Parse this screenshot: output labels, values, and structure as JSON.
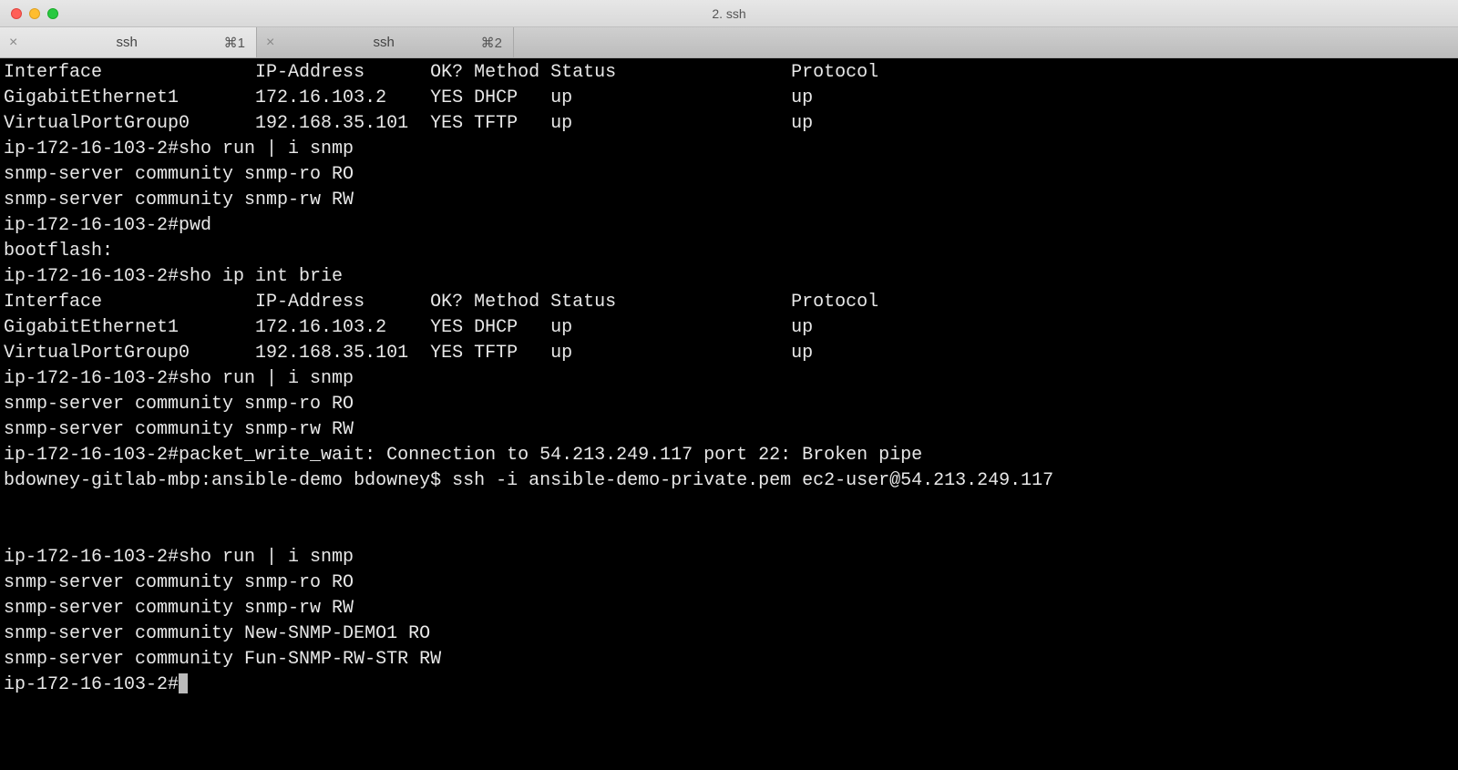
{
  "window": {
    "title": "2. ssh"
  },
  "tabs": [
    {
      "label": "ssh",
      "shortcut": "⌘1",
      "active": true
    },
    {
      "label": "ssh",
      "shortcut": "⌘2",
      "active": false
    }
  ],
  "terminal": {
    "lines": [
      "Interface              IP-Address      OK? Method Status                Protocol",
      "GigabitEthernet1       172.16.103.2    YES DHCP   up                    up",
      "VirtualPortGroup0      192.168.35.101  YES TFTP   up                    up",
      "ip-172-16-103-2#sho run | i snmp",
      "snmp-server community snmp-ro RO",
      "snmp-server community snmp-rw RW",
      "ip-172-16-103-2#pwd",
      "bootflash:",
      "ip-172-16-103-2#sho ip int brie",
      "Interface              IP-Address      OK? Method Status                Protocol",
      "GigabitEthernet1       172.16.103.2    YES DHCP   up                    up",
      "VirtualPortGroup0      192.168.35.101  YES TFTP   up                    up",
      "ip-172-16-103-2#sho run | i snmp",
      "snmp-server community snmp-ro RO",
      "snmp-server community snmp-rw RW",
      "ip-172-16-103-2#packet_write_wait: Connection to 54.213.249.117 port 22: Broken pipe",
      "bdowney-gitlab-mbp:ansible-demo bdowney$ ssh -i ansible-demo-private.pem ec2-user@54.213.249.117",
      "",
      "",
      "ip-172-16-103-2#sho run | i snmp",
      "snmp-server community snmp-ro RO",
      "snmp-server community snmp-rw RW",
      "snmp-server community New-SNMP-DEMO1 RO",
      "snmp-server community Fun-SNMP-RW-STR RW"
    ],
    "prompt": "ip-172-16-103-2#"
  }
}
